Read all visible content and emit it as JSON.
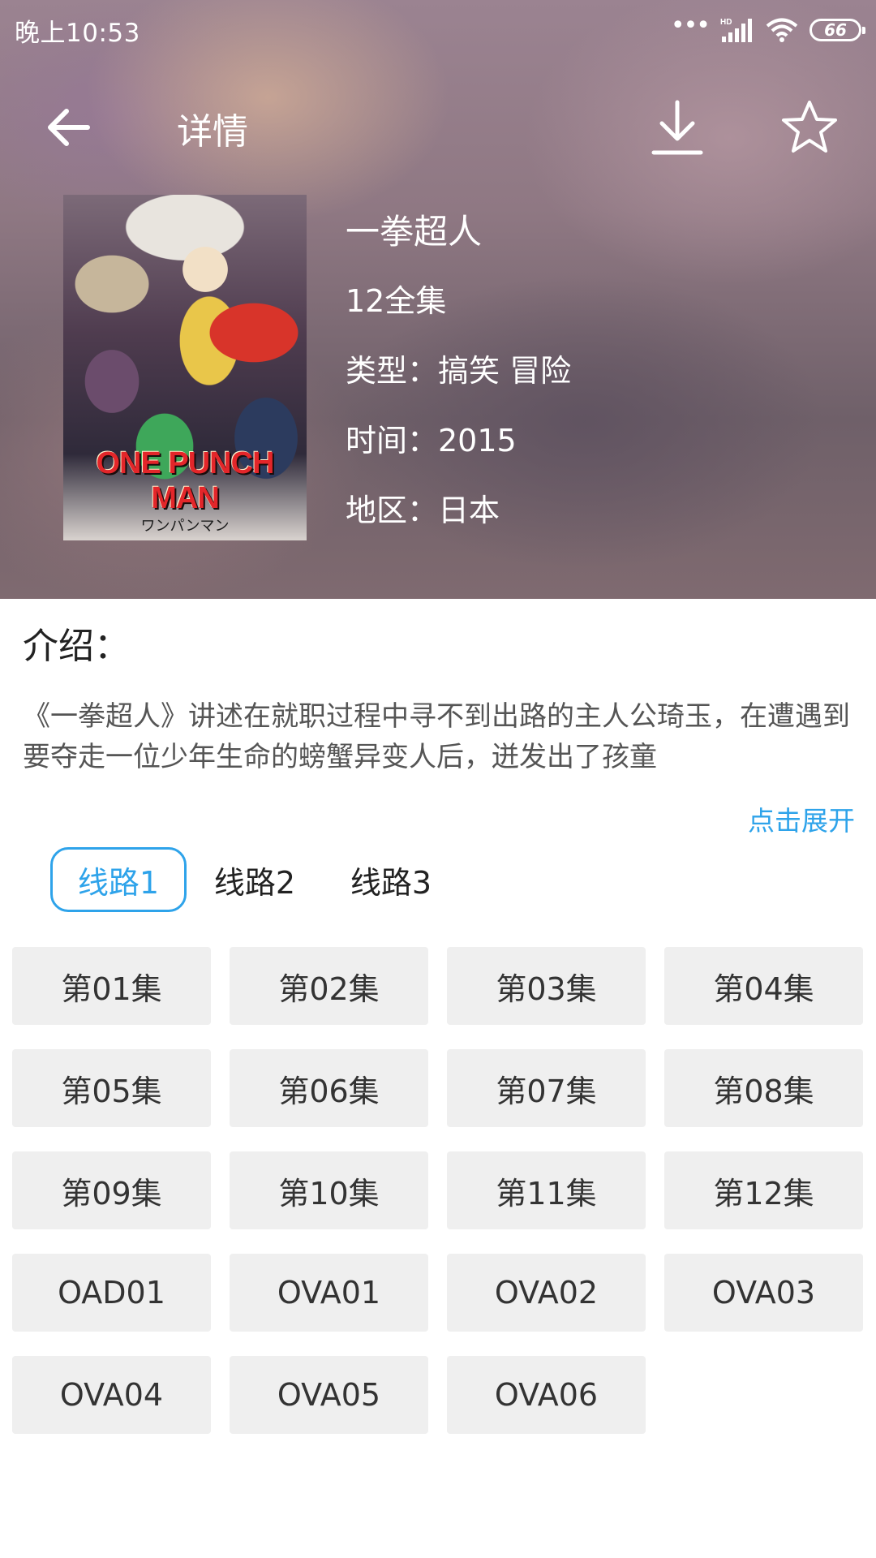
{
  "status_bar": {
    "time": "晚上10:53",
    "signal_label": "HD",
    "battery": "66"
  },
  "toolbar": {
    "title": "详情",
    "back_icon": "back-arrow-icon",
    "download_icon": "download-icon",
    "favorite_icon": "star-outline-icon"
  },
  "poster": {
    "logo_text": "ONE PUNCH MAN",
    "sub_text": "ワンパンマン"
  },
  "anime": {
    "title": "一拳超人",
    "episodes_label": "12全集",
    "genre": "类型：搞笑  冒险",
    "year": "时间：2015",
    "region": "地区：日本"
  },
  "intro": {
    "heading": "介绍：",
    "text": "《一拳超人》讲述在就职过程中寻不到出路的主人公琦玉，在遭遇到要夺走一位少年生命的螃蟹异变人后，迸发出了孩童",
    "expand_label": "点击展开"
  },
  "routes": [
    {
      "label": "线路1",
      "active": true
    },
    {
      "label": "线路2",
      "active": false
    },
    {
      "label": "线路3",
      "active": false
    }
  ],
  "episodes": [
    "第01集",
    "第02集",
    "第03集",
    "第04集",
    "第05集",
    "第06集",
    "第07集",
    "第08集",
    "第09集",
    "第10集",
    "第11集",
    "第12集",
    "OAD01",
    "OVA01",
    "OVA02",
    "OVA03",
    "OVA04",
    "OVA05",
    "OVA06"
  ],
  "colors": {
    "accent": "#2ea3ea",
    "episode_bg": "#efefef"
  }
}
